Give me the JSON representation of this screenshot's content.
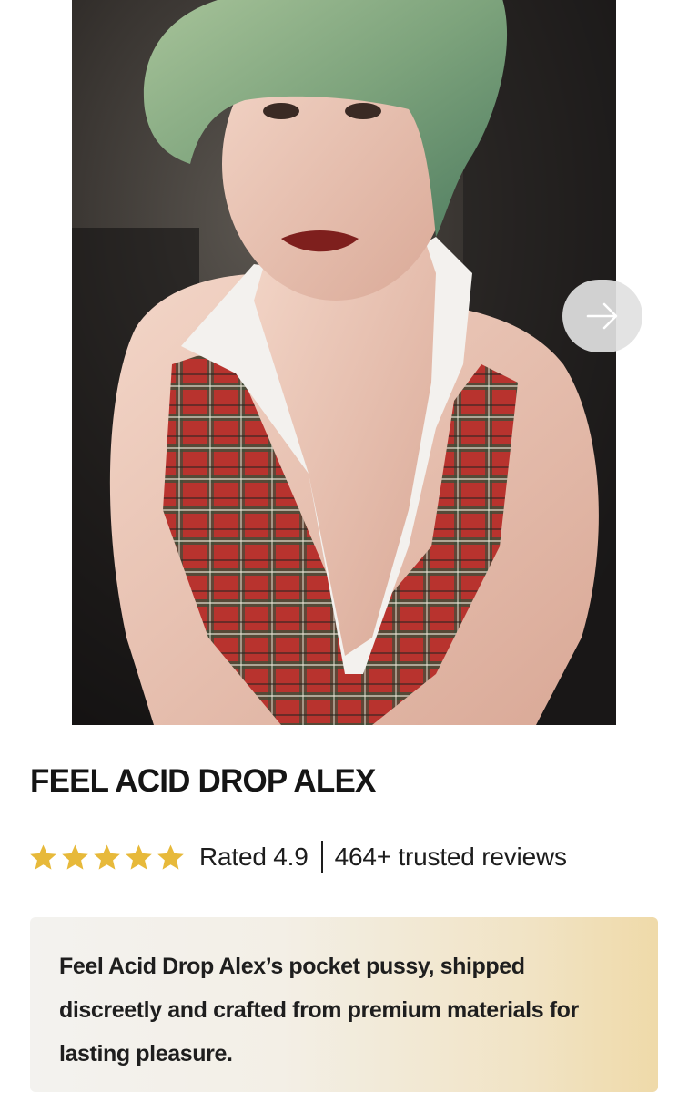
{
  "gallery": {
    "image_alt": "Product photo",
    "next_icon": "arrow-right-icon"
  },
  "product": {
    "title": "FEEL ACID DROP ALEX",
    "star_icon": "star-icon",
    "rating": 4.9,
    "rating_label": "Rated 4.9",
    "reviews_label": "464+ trusted reviews",
    "description": "Feel Acid Drop Alex’s pocket pussy, shipped discreetly and crafted from premium materials for lasting pleasure."
  },
  "colors": {
    "star": "#e7b93a",
    "title": "#151515",
    "description_gradient_start": "#f3f2ef",
    "description_gradient_end": "#efdaa9"
  }
}
